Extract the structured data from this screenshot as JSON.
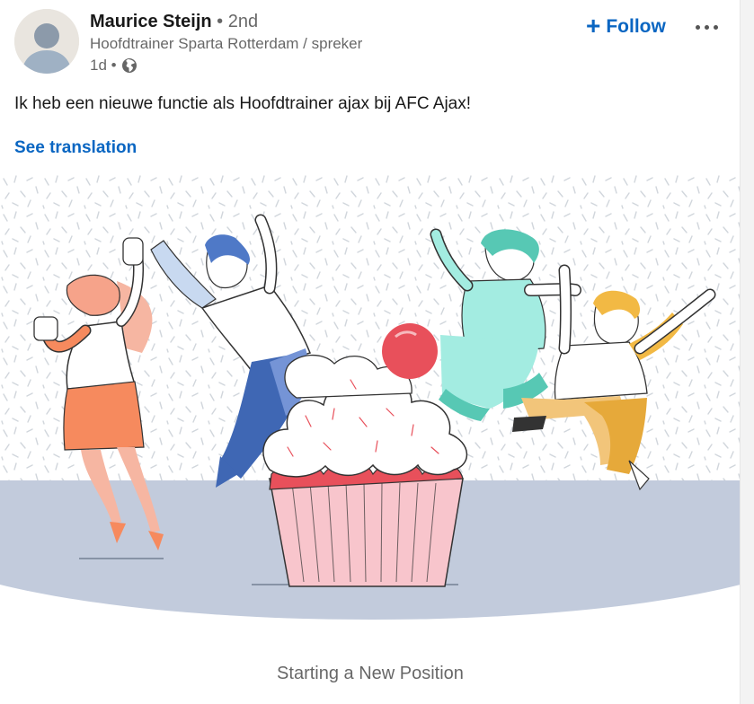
{
  "post": {
    "actor": {
      "name": "Maurice Steijn",
      "degree": "• 2nd",
      "headline": "Hoofdtrainer Sparta Rotterdam / spreker",
      "time": "1d •",
      "visibility_icon": "globe-icon"
    },
    "follow_label": "Follow",
    "follow_icon": "plus-icon",
    "more_icon": "more-horizontal-icon",
    "commentary": "Ik heb een nieuwe functie als Hoofdtrainer ajax bij AFC Ajax!",
    "see_translation": "See translation",
    "image_icon": "celebration-illustration",
    "caption": "Starting a New Position"
  },
  "colors": {
    "brand": "#0a66c2",
    "cupcake_base": "#f8c5cc",
    "cherry": "#e8505b",
    "floor": "#c2cbdc"
  }
}
